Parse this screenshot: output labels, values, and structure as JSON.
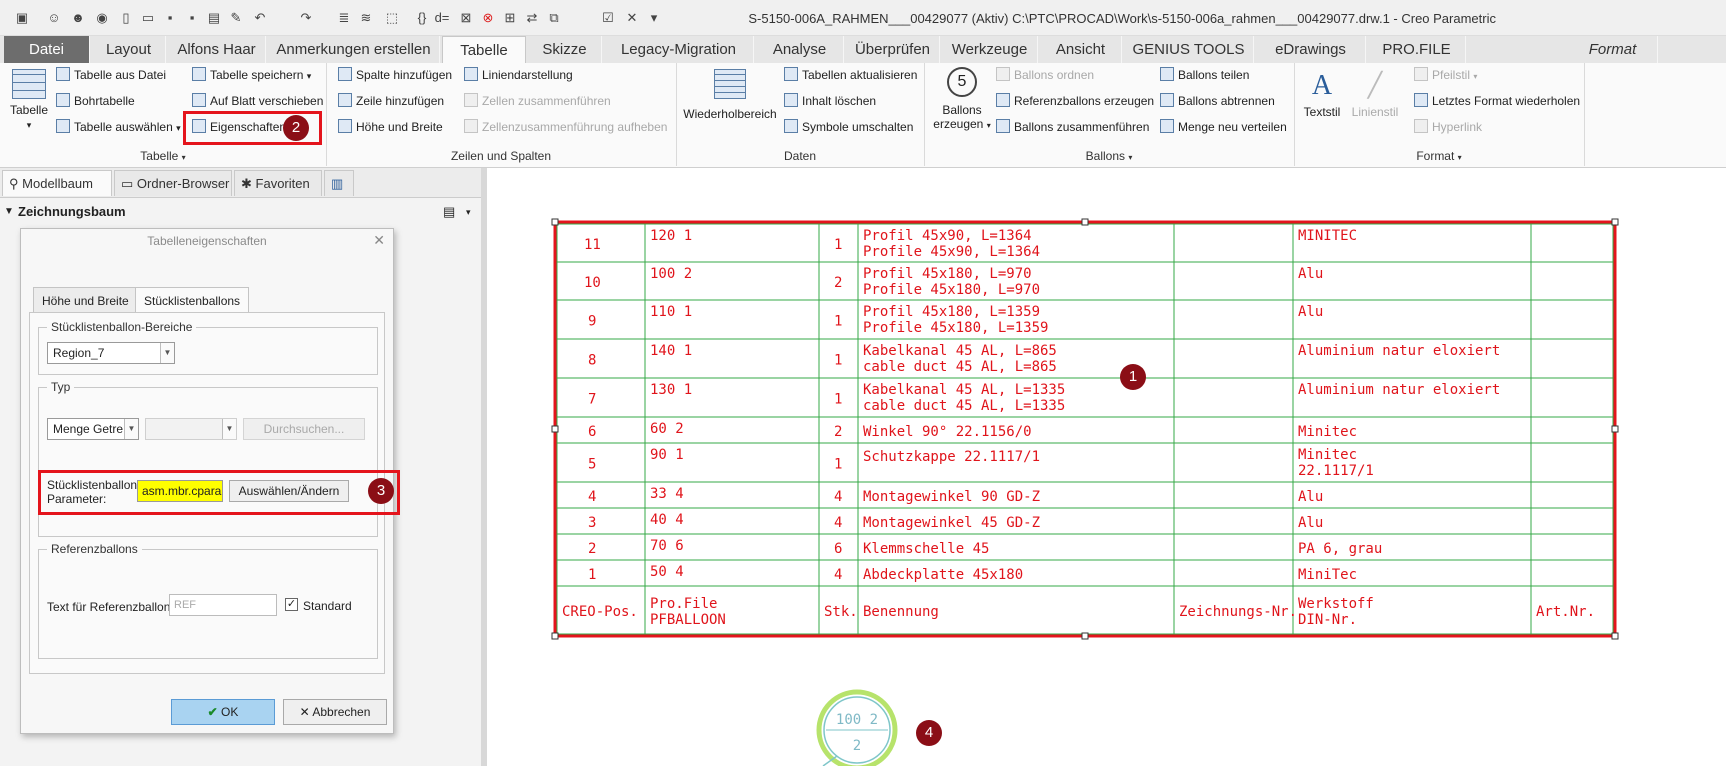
{
  "window": {
    "title": "S-5150-006A_RAHMEN___00429077 (Aktiv) C:\\PTC\\PROCAD\\Work\\s-5150-006a_rahmen___00429077.drw.1 - Creo Parametric"
  },
  "ribbon_tabs": [
    "Datei",
    "Layout",
    "Alfons Haar",
    "Anmerkungen erstellen",
    "Tabelle",
    "Skizze",
    "Legacy-Migration",
    "Analyse",
    "Überprüfen",
    "Werkzeuge",
    "Ansicht",
    "GENIUS TOOLS",
    "eDrawings",
    "PRO.FILE",
    "Format"
  ],
  "ribbon": {
    "tabelle_group": {
      "label": "Tabelle",
      "big_button": "Tabelle",
      "buttons": [
        "Tabelle aus Datei",
        "Bohrtabelle",
        "Tabelle auswählen",
        "Tabelle speichern",
        "Auf Blatt verschieben",
        "Eigenschaften"
      ]
    },
    "zeilen_group": {
      "label": "Zeilen und Spalten",
      "buttons": [
        "Spalte hinzufügen",
        "Zeile hinzufügen",
        "Höhe und Breite",
        "Liniendarstellung",
        "Zellen zusammenführen",
        "Zellenzusammenführung aufheben"
      ]
    },
    "daten_group": {
      "label": "Daten",
      "big_button": "Wiederholbereich",
      "buttons": [
        "Tabellen aktualisieren",
        "Inhalt löschen",
        "Symbole umschalten"
      ]
    },
    "ballons_group": {
      "label": "Ballons",
      "big_button_line1": "Ballons",
      "big_button_line2": "erzeugen",
      "buttons": [
        "Ballons ordnen",
        "Referenzballons erzeugen",
        "Ballons zusammenführen",
        "Ballons teilen",
        "Ballons abtrennen",
        "Menge neu verteilen"
      ]
    },
    "format_group": {
      "label": "Format",
      "big_button1": "Textstil",
      "big_button2": "Linienstil",
      "buttons": [
        "Pfeilstil",
        "Letztes Format wiederholen",
        "Hyperlink"
      ]
    }
  },
  "left_panel": {
    "tabs": [
      "Modellbaum",
      "Ordner-Browser",
      "Favoriten"
    ],
    "tree_header": "Zeichnungsbaum"
  },
  "dialog": {
    "title": "Tabelleneigenschaften",
    "tabs": [
      "Höhe und Breite",
      "Stücklistenballons"
    ],
    "bereiche_legend": "Stücklistenballon-Bereiche",
    "region_value": "Region_7",
    "typ_legend": "Typ",
    "typ_value": "Menge Getre",
    "typ_browse": "Durchsuchen...",
    "param_label_line1": "Stücklistenballon",
    "param_label_line2": "Parameter:",
    "param_value": "asm.mbr.cparar",
    "param_button": "Auswählen/Ändern",
    "ref_legend": "Referenzballons",
    "ref_label": "Text für Referenzballons",
    "ref_value": "REF",
    "standard_label": "Standard",
    "standard_checked": "✓",
    "ok": "OK",
    "cancel": "Abbrechen"
  },
  "bom_table": {
    "rows": [
      [
        "11",
        "120  1",
        "1",
        "Profil 45x90, L=1364",
        "Profile 45x90, L=1364",
        "",
        "MINITEC",
        ""
      ],
      [
        "10",
        "100  2",
        "2",
        "Profil 45x180, L=970",
        "Profile 45x180, L=970",
        "",
        "Alu",
        ""
      ],
      [
        "9",
        "110  1",
        "1",
        "Profil 45x180, L=1359",
        "Profile 45x180, L=1359",
        "",
        "Alu",
        ""
      ],
      [
        "8",
        "140  1",
        "1",
        "Kabelkanal 45 AL,  L=865",
        "cable duct 45 AL,  L=865",
        "",
        "Aluminium natur eloxiert",
        ""
      ],
      [
        "7",
        "130  1",
        "1",
        "Kabelkanal 45 AL,  L=1335",
        "cable duct 45 AL,  L=1335",
        "",
        "Aluminium natur eloxiert",
        ""
      ],
      [
        "6",
        "60  2",
        "2",
        "Winkel 90° 22.1156/0",
        "",
        "",
        "Minitec",
        ""
      ],
      [
        "5",
        "90  1",
        "1",
        "Schutzkappe 22.1117/1",
        "",
        "",
        "Minitec\n22.1117/1",
        ""
      ],
      [
        "4",
        "33  4",
        "4",
        "Montagewinkel 90 GD-Z",
        "",
        "",
        "Alu",
        ""
      ],
      [
        "3",
        "40  4",
        "4",
        "Montagewinkel 45 GD-Z",
        "",
        "",
        "Alu",
        ""
      ],
      [
        "2",
        "70  6",
        "6",
        "Klemmschelle 45",
        "",
        "",
        "PA 6, grau",
        ""
      ],
      [
        "1",
        "50  4",
        "4",
        "Abdeckplatte 45x180",
        "",
        "",
        "MiniTec",
        ""
      ]
    ],
    "header": [
      "CREO-Pos.",
      "Pro.File\nPFBALLOON",
      "Stk.",
      "Benennung",
      "Zeichnungs-Nr.",
      "Werkstoff\nDIN-Nr.",
      "Art.Nr."
    ]
  },
  "balloon": {
    "top": "100  2",
    "bottom": "2"
  },
  "callouts": [
    "1",
    "2",
    "3",
    "4"
  ],
  "colors": {
    "callout": "#8b0e16",
    "highlight_box": "#e4141c",
    "table_lines": "#35a847",
    "table_text": "#e0141b",
    "param_highlight": "#ffff00"
  }
}
